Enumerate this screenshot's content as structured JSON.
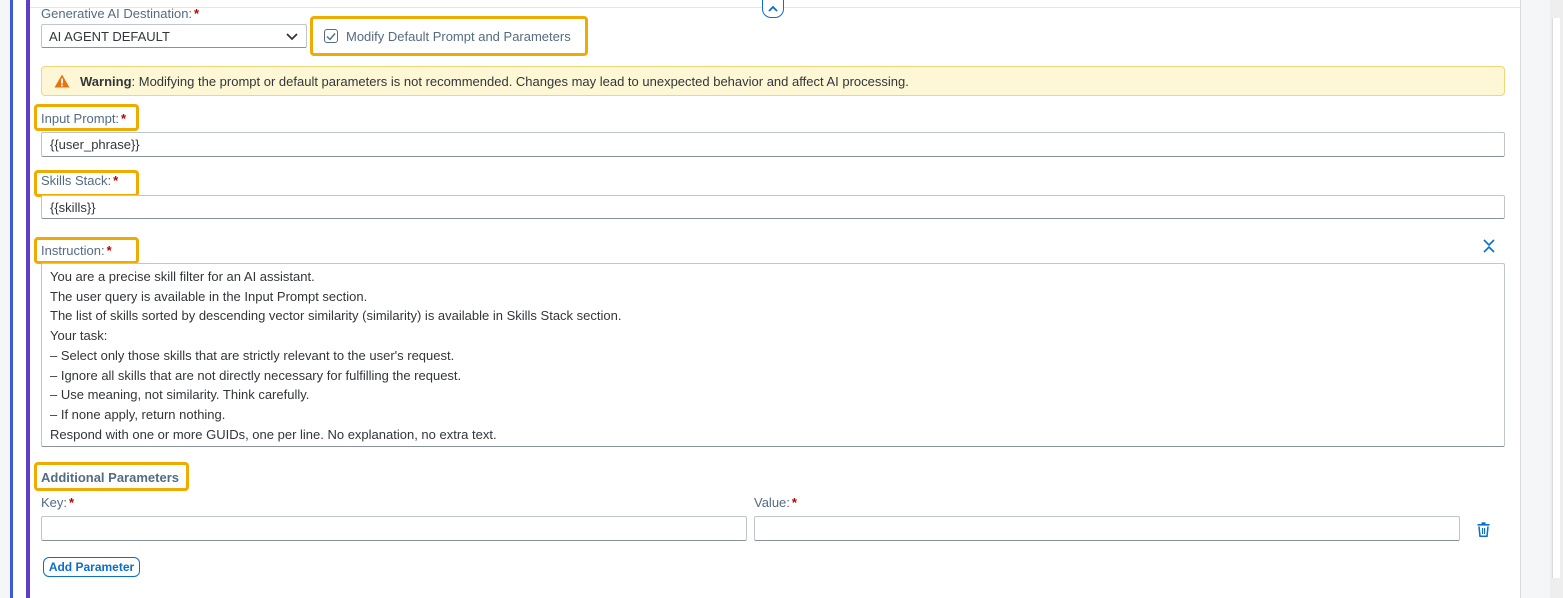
{
  "destination": {
    "label": "Generative AI Destination:",
    "required_marker": "*",
    "selected_value": "AI AGENT DEFAULT",
    "icon": "chevron-down-icon"
  },
  "modify_checkbox": {
    "label": "Modify Default Prompt and Parameters",
    "checked": true
  },
  "warning": {
    "title": "Warning",
    "message": ": Modifying the prompt or default parameters is not recommended. Changes may lead to unexpected behavior and affect AI processing.",
    "icon": "warning-icon"
  },
  "input_prompt": {
    "label": "Input Prompt:",
    "required_marker": "*",
    "value": "{{user_phrase}}"
  },
  "skills_stack": {
    "label": "Skills Stack:",
    "required_marker": "*",
    "value": "{{skills}}"
  },
  "instruction": {
    "label": "Instruction:",
    "required_marker": "*",
    "collapse_icon": "collapse-icon",
    "lines": [
      "You are a precise skill filter for an AI assistant.",
      "The user query is available in the Input Prompt section.",
      "The list of skills sorted by descending vector similarity (similarity) is available in Skills Stack section.",
      "Your task:",
      "– Select only those skills that are strictly relevant to the user's request.",
      "– Ignore all skills that are not directly necessary for fulfilling the request.",
      "– Use meaning, not similarity. Think carefully.",
      "– If none apply, return nothing.",
      "Respond with one or more GUIDs, one per line. No explanation, no extra text."
    ]
  },
  "additional_parameters": {
    "title": "Additional Parameters",
    "key_label": "Key:",
    "value_label": "Value:",
    "required_marker": "*",
    "key_value": "",
    "value_value": "",
    "delete_icon": "trash-icon",
    "add_button": "Add Parameter"
  },
  "colors": {
    "accent": "#0a6ed1",
    "highlight": "#f0ab00",
    "required": "#bb0000",
    "warning_bg": "#fef7d5"
  }
}
